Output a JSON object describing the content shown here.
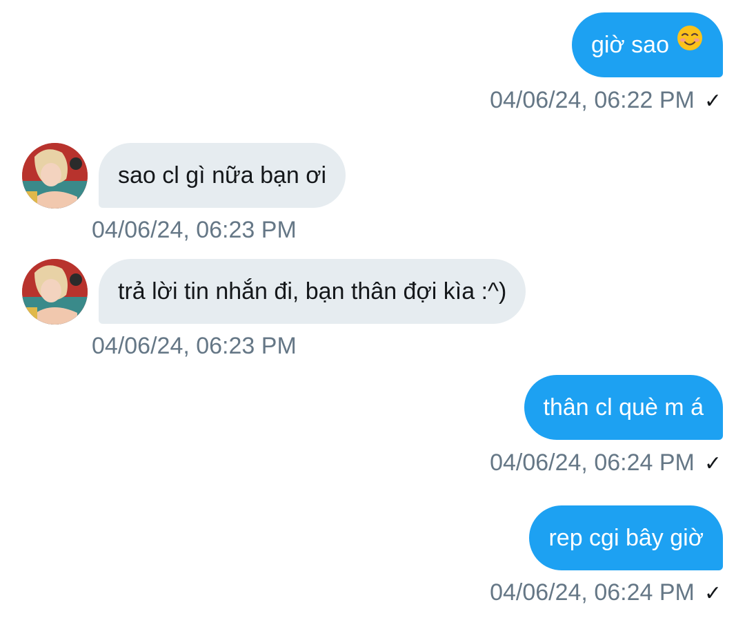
{
  "messages": [
    {
      "direction": "out",
      "text": "giờ sao",
      "emoji": "smiling-face-with-blush",
      "timestamp": "04/06/24, 06:22 PM",
      "status": "✓"
    },
    {
      "direction": "in",
      "text": "sao cl gì nữa bạn ơi",
      "timestamp": "04/06/24, 06:23 PM"
    },
    {
      "direction": "in",
      "text": "trả lời tin nhắn đi, bạn thân đợi kìa :^)",
      "timestamp": "04/06/24, 06:23 PM"
    },
    {
      "direction": "out",
      "text": "thân cl què m á",
      "timestamp": "04/06/24, 06:24 PM",
      "status": "✓"
    },
    {
      "direction": "out",
      "text": "rep cgi bây giờ",
      "timestamp": "04/06/24, 06:24 PM",
      "status": "✓"
    }
  ],
  "colors": {
    "outgoing_bubble": "#1da1f2",
    "incoming_bubble": "#e6ecf0",
    "timestamp": "#657786"
  }
}
